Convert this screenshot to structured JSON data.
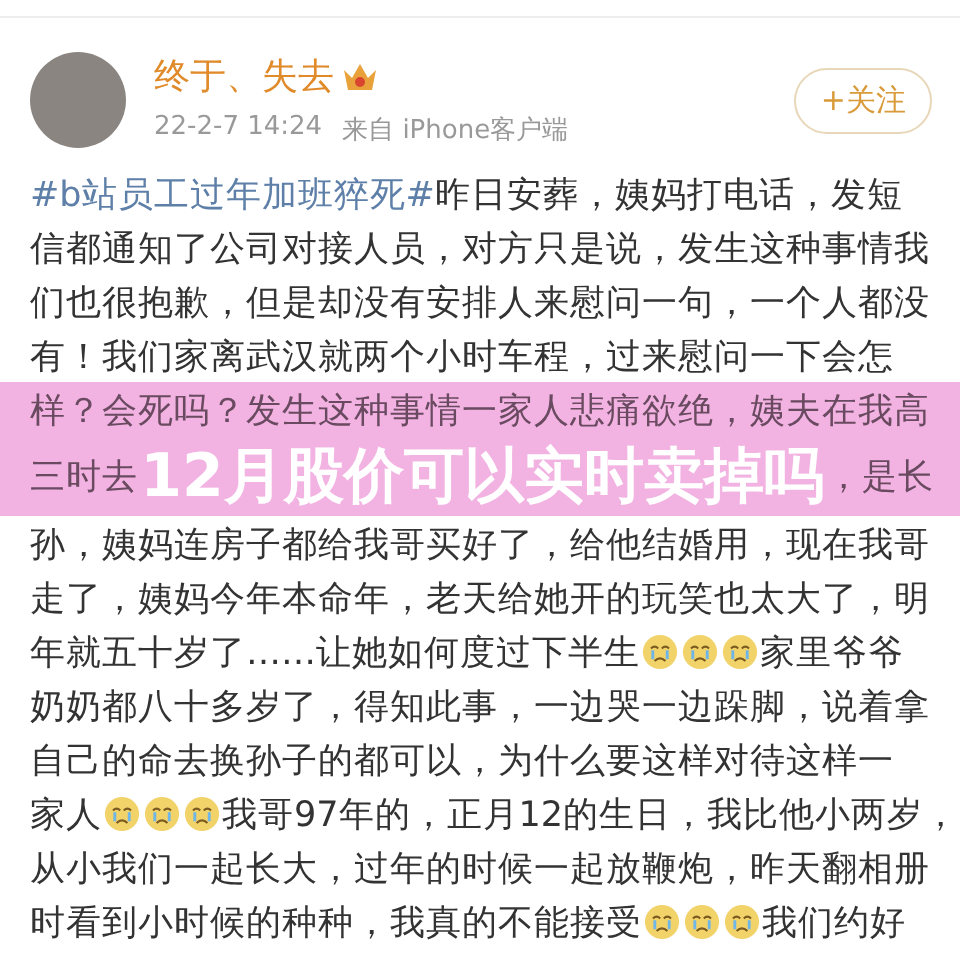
{
  "post": {
    "author": {
      "name": "终于、失去",
      "time": "22-2-7 14:24",
      "source": "来自 iPhone客户端"
    },
    "follow_button": {
      "label": "+关注"
    },
    "lines": [
      [
        {
          "kind": "hashtag",
          "text": "#b站员工过年加班猝死#"
        },
        {
          "kind": "text",
          "text": "昨日安葬，姨妈打电话，发短"
        }
      ],
      [
        {
          "kind": "text",
          "text": "信都通知了公司对接人员，对方只是说，发生这种事情我"
        }
      ],
      [
        {
          "kind": "text",
          "text": "们也很抱歉，但是却没有安排人来慰问一句，一个人都没"
        }
      ],
      [
        {
          "kind": "text",
          "text": "有！我们家离武汉就两个小时车程，过来慰问一下会怎"
        }
      ]
    ]
  },
  "banner": {
    "title": "12月股价可以实时卖掉吗",
    "lines": [
      [
        {
          "kind": "text",
          "text": "样？会死吗？发生这种事情一家人悲痛欲绝，姨夫在我高"
        }
      ],
      [
        {
          "kind": "text",
          "text": "三时去"
        },
        {
          "kind": "covered"
        },
        {
          "kind": "text",
          "text": "，是长"
        }
      ]
    ]
  },
  "post_continued": {
    "lines": [
      [
        {
          "kind": "text",
          "text": "孙，姨妈连房子都给我哥买好了，给他结婚用，现在我哥"
        }
      ],
      [
        {
          "kind": "text",
          "text": "走了，姨妈今年本命年，老天给她开的玩笑也太大了，明"
        }
      ],
      [
        {
          "kind": "text",
          "text": "年就五十岁了……让她如何度过下半生"
        },
        {
          "kind": "emoji"
        },
        {
          "kind": "emoji"
        },
        {
          "kind": "emoji"
        },
        {
          "kind": "text",
          "text": "家里爷爷"
        }
      ],
      [
        {
          "kind": "text",
          "text": "奶奶都八十多岁了，得知此事，一边哭一边跺脚，说着拿"
        }
      ],
      [
        {
          "kind": "text",
          "text": "自己的命去换孙子的都可以，为什么要这样对待这样一"
        }
      ],
      [
        {
          "kind": "text",
          "text": "家人"
        },
        {
          "kind": "emoji"
        },
        {
          "kind": "emoji"
        },
        {
          "kind": "emoji"
        },
        {
          "kind": "text",
          "text": "我哥97年的，正月12的生日，我比他小两岁，"
        }
      ],
      [
        {
          "kind": "text",
          "text": "从小我们一起长大，过年的时候一起放鞭炮，昨天翻相册"
        }
      ],
      [
        {
          "kind": "text",
          "text": "时看到小时候的种种，我真的不能接受"
        },
        {
          "kind": "emoji"
        },
        {
          "kind": "emoji"
        },
        {
          "kind": "emoji"
        },
        {
          "kind": "text",
          "text": "我们约好"
        }
      ]
    ]
  }
}
